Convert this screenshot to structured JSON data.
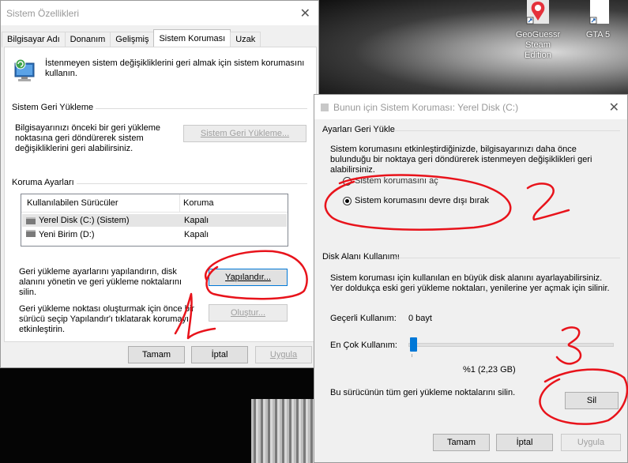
{
  "desktop": {
    "icons": [
      {
        "id": "geoguessr",
        "label_lines": [
          "GeoGuessr",
          "Steam",
          "Edition"
        ]
      },
      {
        "id": "gta5",
        "label_lines": [
          "GTA 5"
        ]
      }
    ]
  },
  "sysprops": {
    "title": "Sistem Özellikleri",
    "tabs": [
      "Bilgisayar Adı",
      "Donanım",
      "Gelişmiş",
      "Sistem Koruması",
      "Uzak"
    ],
    "active_tab": "Sistem Koruması",
    "intro": "İstenmeyen sistem değişikliklerini geri almak için sistem korumasını kullanın.",
    "restore_section": "Sistem Geri Yükleme",
    "restore_text": "Bilgisayarınızı önceki bir geri yükleme noktasına geri döndürerek sistem değişikliklerini geri alabilirsiniz.",
    "restore_button": "Sistem Geri Yükleme...",
    "protection_section": "Koruma Ayarları",
    "list_headers": {
      "drives": "Kullanılabilen Sürücüler",
      "protection": "Koruma"
    },
    "drives": [
      {
        "name": "Yerel Disk (C:) (Sistem)",
        "status": "Kapalı"
      },
      {
        "name": "Yeni Birim (D:)",
        "status": "Kapalı"
      }
    ],
    "configure_text": "Geri yükleme ayarlarını yapılandırın, disk alanını yönetin ve geri yükleme noktalarını silin.",
    "configure_button": "Yapılandır...",
    "create_text": "Geri yükleme noktası oluşturmak için önce bir sürücü seçip Yapılandır'ı tıklatarak korumayı etkinleştirin.",
    "create_button": "Oluştur...",
    "ok_button": "Tamam",
    "cancel_button": "İptal",
    "apply_button": "Uygula"
  },
  "dialog": {
    "title": "Bunun için Sistem Koruması: Yerel Disk (C:)",
    "restore_group": "Ayarları Geri Yükle",
    "restore_desc": "Sistem korumasını etkinleştirdiğinizde, bilgisayarınızı daha önce bulunduğu bir noktaya geri döndürerek istenmeyen değişiklikleri geri alabilirsiniz.",
    "radio_on": "Sistem korumasını aç",
    "radio_off": "Sistem korumasını devre dışı bırak",
    "selected_radio": "radio_off",
    "disk_group": "Disk Alanı Kullanımı",
    "disk_desc": "Sistem koruması için kullanılan en büyük disk alanını ayarlayabilirsiniz. Yer doldukça eski geri yükleme noktaları, yenilerine yer açmak için silinir.",
    "current_label": "Geçerli Kullanım:",
    "current_value": "0 bayt",
    "max_label": "En Çok Kullanım:",
    "slider_value": 0.01,
    "slider_readout": "%1 (2,23 GB)",
    "delete_text": "Bu sürücünün tüm geri yükleme noktalarını silin.",
    "delete_button": "Sil",
    "ok_button": "Tamam",
    "cancel_button": "İptal",
    "apply_button": "Uygula"
  },
  "annotations": {
    "color": "#e8131b",
    "labels": [
      "1",
      "2",
      "3"
    ]
  }
}
